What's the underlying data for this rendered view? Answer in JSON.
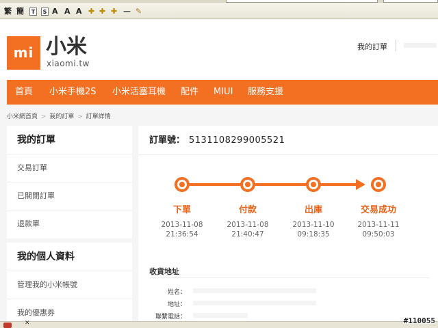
{
  "browser": {
    "toolbar": {
      "btn_trad": "繁",
      "btn_simp": "簡",
      "btn_t": "T",
      "btn_s": "S",
      "btn_a1": "A",
      "btn_a2": "A",
      "btn_a3": "A",
      "btn_plus": "✚",
      "btn_minus": "—"
    }
  },
  "header": {
    "logo_mark": "mi",
    "logo_name": "小米",
    "logo_sub": "xiaomi.tw",
    "my_orders_link": "我的訂單"
  },
  "nav": {
    "items": [
      "首頁",
      "小米手機2S",
      "小米活塞耳機",
      "配件",
      "MIUI",
      "服務支援"
    ]
  },
  "breadcrumb": {
    "items": [
      "小米網首頁",
      "我的訂單",
      "訂單詳情"
    ],
    "separator": ">"
  },
  "sidebar": {
    "orders_title": "我的訂單",
    "orders_items": [
      "交易訂單",
      "已關閉訂單",
      "退款單"
    ],
    "profile_title": "我的個人資料",
    "profile_items": [
      "管理我的小米帳號",
      "我的優惠券"
    ]
  },
  "order": {
    "number_label": "訂單號：",
    "number": "5131108299005521",
    "steps": [
      {
        "label": "下單",
        "date": "2013-11-08",
        "time": "21:36:54"
      },
      {
        "label": "付款",
        "date": "2013-11-08",
        "time": "21:40:47"
      },
      {
        "label": "出庫",
        "date": "2013-11-10",
        "time": "09:18:35"
      },
      {
        "label": "交易成功",
        "date": "2013-11-11",
        "time": "09:50:03"
      }
    ],
    "address": {
      "title": "收貨地址",
      "name_label": "姓名：",
      "addr_label": "地址：",
      "phone_label": "聯繫電話："
    }
  },
  "colors": {
    "accent": "#f36f21"
  },
  "watermark": "#110055"
}
